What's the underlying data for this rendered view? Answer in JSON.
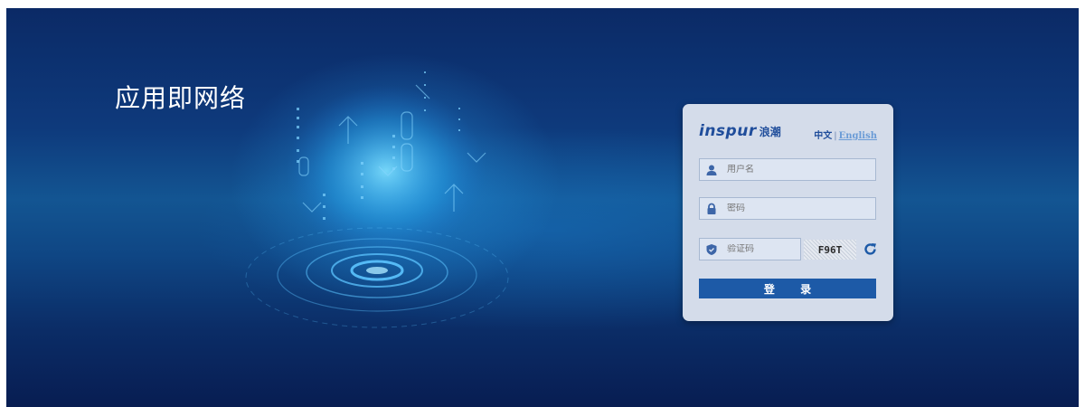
{
  "hero": {
    "headline": "应用即网络"
  },
  "login": {
    "brand_latin": "inspur",
    "brand_cn": "浪潮",
    "lang_zh": "中文",
    "lang_sep": "|",
    "lang_en": "English",
    "username_placeholder": "用户名",
    "password_placeholder": "密码",
    "captcha_placeholder": "验证码",
    "captcha_code": "F96T",
    "submit_label": "登 录"
  },
  "icons": {
    "username": "user-icon",
    "password": "lock-icon",
    "captcha": "shield-icon",
    "refresh": "refresh-icon"
  },
  "colors": {
    "background_dark": "#081d52",
    "background_mid": "#135592",
    "card": "#d4dcea",
    "brand": "#1f4d9b",
    "button": "#1d5aa7",
    "icon": "#3d66a8"
  }
}
